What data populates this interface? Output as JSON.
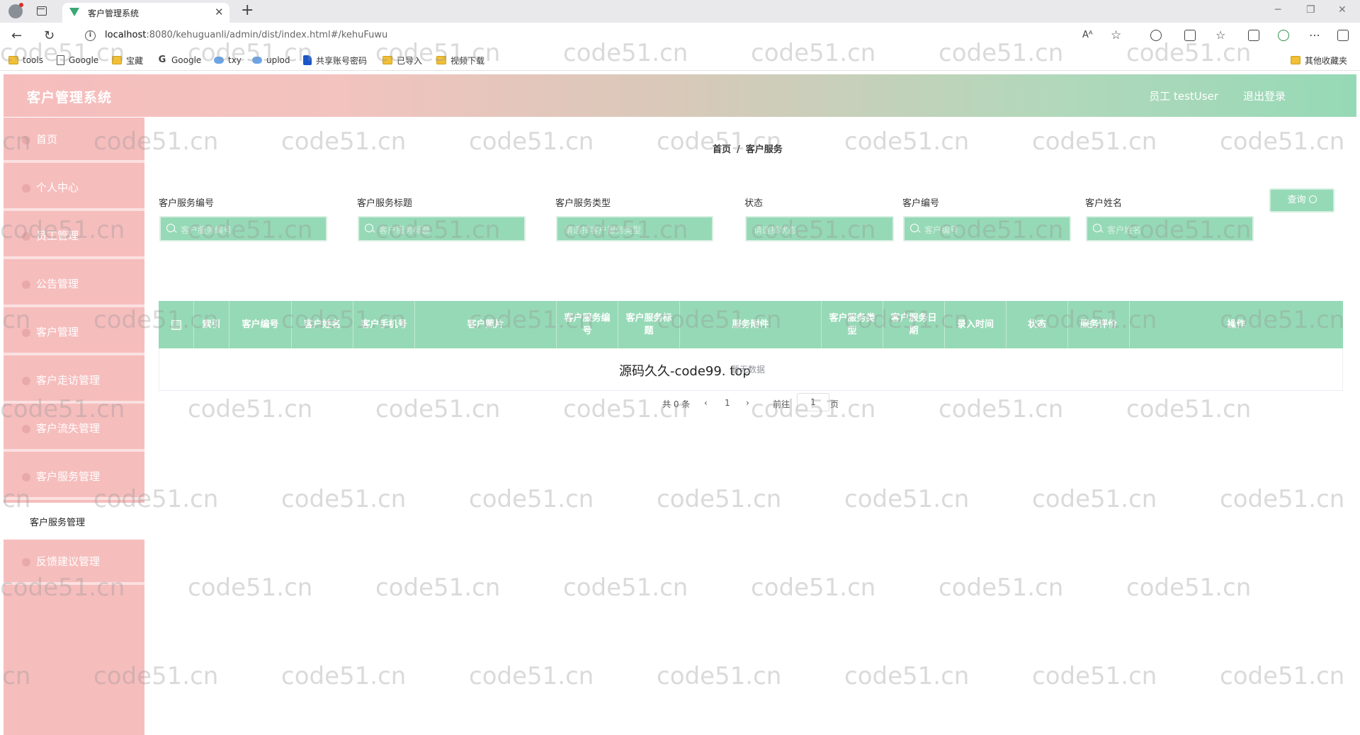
{
  "browser": {
    "tab_title": "客户管理系统",
    "url_host": "localhost",
    "url_rest": ":8080/kehuguanli/admin/dist/index.html#/kehuFuwu",
    "bookmarks": [
      {
        "label": "tools",
        "icon": "folder-icon"
      },
      {
        "label": "Google",
        "icon": "page-icon"
      },
      {
        "label": "宝藏",
        "icon": "folder-icon"
      },
      {
        "label": "Google",
        "icon": "google-icon"
      },
      {
        "label": "txy",
        "icon": "cloud-icon"
      },
      {
        "label": "uplod",
        "icon": "cloud-icon"
      },
      {
        "label": "共享账号密码",
        "icon": "feishu-icon"
      },
      {
        "label": "已导入",
        "icon": "folder-icon"
      },
      {
        "label": "视频下载",
        "icon": "folder-icon"
      }
    ],
    "other_bookmarks": "其他收藏夹"
  },
  "header": {
    "brand": "客户管理系统",
    "user": "员工 testUser",
    "logout": "退出登录"
  },
  "sidebar": {
    "items": [
      {
        "label": "首页"
      },
      {
        "label": "个人中心"
      },
      {
        "label": "员工管理"
      },
      {
        "label": "公告管理"
      },
      {
        "label": "客户管理"
      },
      {
        "label": "客户走访管理"
      },
      {
        "label": "客户流失管理"
      },
      {
        "label": "客户服务管理"
      },
      {
        "label": "反馈建议管理"
      }
    ],
    "active_sub": "客户服务管理"
  },
  "breadcrumb": {
    "home": "首页",
    "sep": "/",
    "current": "客户服务"
  },
  "filters": [
    {
      "label": "客户服务编号",
      "placeholder": "客户服务编号"
    },
    {
      "label": "客户服务标题",
      "placeholder": "客户服务标题"
    },
    {
      "label": "客户服务类型",
      "placeholder": "请选择客户服务类型"
    },
    {
      "label": "状态",
      "placeholder": "请选择状态"
    },
    {
      "label": "客户编号",
      "placeholder": "客户编号"
    },
    {
      "label": "客户姓名",
      "placeholder": "客户姓名"
    }
  ],
  "query_button": "查询",
  "table": {
    "columns": [
      "索引",
      "客户编号",
      "客户姓名",
      "客户手机号",
      "客户照片",
      "客户服务编号",
      "客户服务标题",
      "服务附件",
      "客户服务类型",
      "客户服务日期",
      "录入时间",
      "状态",
      "服务评价",
      "操作"
    ],
    "empty_text": "暂无数据"
  },
  "overlay_text": "源码久久-code99. top",
  "pagination": {
    "total": "共 0 条",
    "prev": "‹",
    "current": "1",
    "next": "›",
    "goto": "前往",
    "goto_value": "1",
    "page_unit": "页"
  },
  "watermark": "code51.cn"
}
